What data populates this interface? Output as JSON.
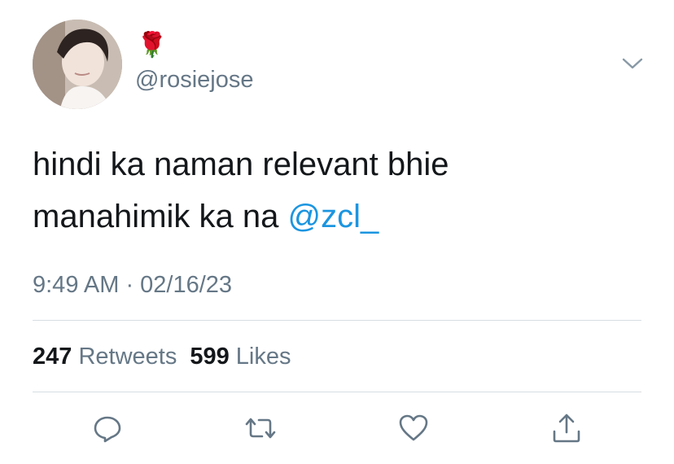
{
  "tweet": {
    "display_name": "🌹",
    "handle": "@rosiejose",
    "text_before_mention": "hindi ka naman relevant bhie\nmanahimik ka na ",
    "mention": "@zcl_",
    "timestamp": "9:49 AM · 02/16/23"
  },
  "stats": {
    "retweets_count": "247",
    "retweets_label": "Retweets",
    "likes_count": "599",
    "likes_label": "Likes"
  },
  "icons": {
    "menu": "chevron-down-icon",
    "reply": "reply-icon",
    "retweet": "retweet-icon",
    "like": "heart-icon",
    "share": "share-icon"
  },
  "colors": {
    "link": "#1b95e0",
    "secondary_text": "#657786",
    "icon": "#657786",
    "divider": "#d7dde2"
  }
}
